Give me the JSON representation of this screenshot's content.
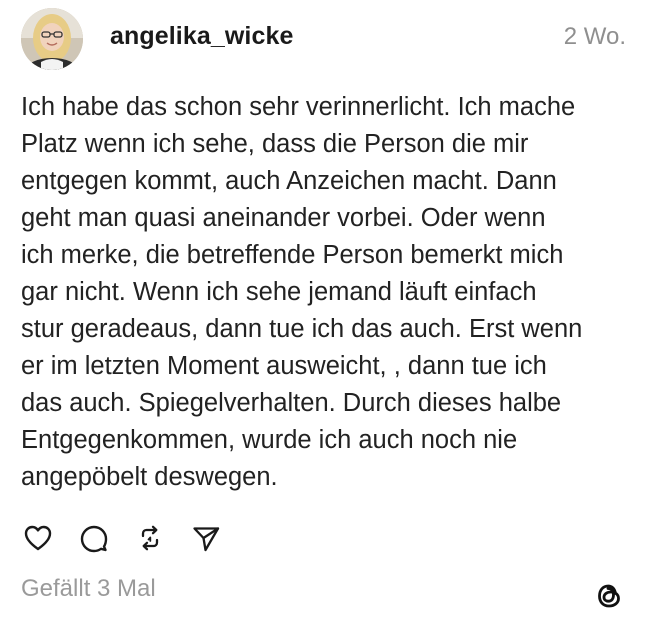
{
  "post": {
    "username": "angelika_wicke",
    "timestamp": "2 Wo.",
    "text_lines": [
      "Ich habe das schon sehr verinnerlicht. Ich mache",
      "Platz wenn ich sehe, dass die Person die mir",
      "entgegen kommt, auch Anzeichen macht. Dann",
      "geht man quasi aneinander vorbei. Oder wenn",
      "ich merke, die betreffende Person bemerkt mich",
      "gar nicht. Wenn ich sehe jemand läuft einfach",
      "stur geradeaus, dann tue ich das auch. Erst wenn",
      "er im letzten Moment ausweicht, , dann tue ich",
      "das auch. Spiegelverhalten. Durch dieses halbe",
      "Entgegenkommen, wurde ich auch noch nie",
      "angepöbelt deswegen."
    ],
    "likes": "Gefällt 3 Mal"
  },
  "icons": {
    "like": "heart-icon",
    "comment": "comment-bubble-icon",
    "repost": "repost-icon",
    "share": "send-icon",
    "brand": "threads-logo-icon"
  },
  "colors": {
    "text": "#222222",
    "muted": "#8f8f8f",
    "background": "#ffffff"
  }
}
